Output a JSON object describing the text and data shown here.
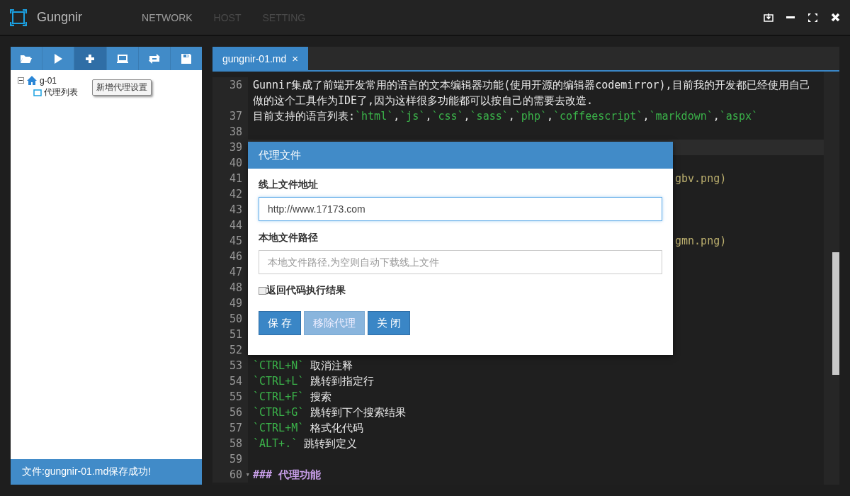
{
  "app": {
    "title": "Gungnir"
  },
  "nav": [
    {
      "label": "NETWORK",
      "selected": true
    },
    {
      "label": "HOST",
      "selected": false
    },
    {
      "label": "SETTING",
      "selected": false
    }
  ],
  "toolbar": [
    {
      "kind": "folder",
      "selected": false
    },
    {
      "kind": "play",
      "selected": false
    },
    {
      "kind": "plus",
      "selected": true
    },
    {
      "kind": "laptop",
      "selected": false
    },
    {
      "kind": "refresh",
      "selected": false
    },
    {
      "kind": "save",
      "selected": false
    }
  ],
  "tooltip": "新增代理设置",
  "tree": [
    {
      "label": "g-01",
      "kind": "home",
      "expanded": true,
      "children": [
        {
          "label": "代理列表",
          "kind": "list"
        }
      ]
    }
  ],
  "status_message": "文件:gungnir-01.md保存成功!",
  "editor_tabs": [
    {
      "label": "gungnir-01.md",
      "close": "×",
      "selected": true
    }
  ],
  "lines": [
    {
      "number": "36",
      "segments": [
        {
          "kind": "text",
          "text": "Gunnir集成了前端开发常用的语言的文本编辑器功能(使用开源的编辑器codemirror),目前我的开发都已经使用自己做的这个工具作为IDE了,因为这样很多功能都可以按自己的需要去改造."
        }
      ]
    },
    {
      "number": "37",
      "segments": [
        {
          "kind": "text",
          "text": "目前支持的语言列表:"
        },
        {
          "kind": "code_list",
          "text": "`html`,`js`,`css`,`sass`,`php`,`coffeescript`,`markdown`,`aspx`"
        }
      ]
    },
    {
      "number": "38"
    },
    {
      "number": "39",
      "active": true
    },
    {
      "number": "40"
    },
    {
      "number": "41",
      "segments": [
        {
          "kind": "tail",
          "text": "gbv.png)"
        }
      ]
    },
    {
      "number": "42"
    },
    {
      "number": "43"
    },
    {
      "number": "44"
    },
    {
      "number": "45",
      "segments": [
        {
          "kind": "tail",
          "text": "gmn.png)"
        }
      ]
    },
    {
      "number": "46"
    },
    {
      "number": "47"
    },
    {
      "number": "48"
    },
    {
      "number": "49"
    },
    {
      "number": "50"
    },
    {
      "number": "51"
    },
    {
      "number": "52"
    },
    {
      "number": "53",
      "segments": [
        {
          "kind": "code",
          "text": "`CTRL+N`"
        },
        {
          "kind": "text",
          "text": " 取消注释"
        }
      ]
    },
    {
      "number": "54",
      "segments": [
        {
          "kind": "code",
          "text": "`CTRL+L`"
        },
        {
          "kind": "text",
          "text": " 跳转到指定行"
        }
      ]
    },
    {
      "number": "55",
      "segments": [
        {
          "kind": "code",
          "text": "`CTRL+F`"
        },
        {
          "kind": "text",
          "text": " 搜索"
        }
      ]
    },
    {
      "number": "56",
      "segments": [
        {
          "kind": "code",
          "text": "`CTRL+G`"
        },
        {
          "kind": "text",
          "text": " 跳转到下个搜索结果"
        }
      ]
    },
    {
      "number": "57",
      "segments": [
        {
          "kind": "code",
          "text": "`CTRL+M`"
        },
        {
          "kind": "text",
          "text": " 格式化代码"
        }
      ]
    },
    {
      "number": "58",
      "segments": [
        {
          "kind": "code",
          "text": "`ALT+.`"
        },
        {
          "kind": "text",
          "text": " 跳转到定义"
        }
      ]
    },
    {
      "number": "59"
    },
    {
      "number": "60",
      "fold": "▾",
      "segments": [
        {
          "kind": "heading",
          "text": "### 代理功能"
        }
      ]
    }
  ],
  "dialog": {
    "title": "代理文件",
    "fields": [
      {
        "label": "线上文件地址",
        "value": "http://www.17173.com",
        "focused": true
      },
      {
        "label": "本地文件路径",
        "placeholder": "本地文件路径,为空则自动下载线上文件",
        "focused": false
      }
    ],
    "checkbox": {
      "label": "返回代码执行结果",
      "checked": false
    },
    "buttons": [
      {
        "label": "保 存",
        "disabled": false
      },
      {
        "label": "移除代理",
        "disabled": true
      },
      {
        "label": "关 闭",
        "disabled": false
      }
    ]
  }
}
